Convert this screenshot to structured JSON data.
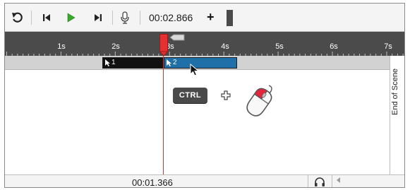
{
  "toolbar": {
    "icons": [
      "undo-icon",
      "skip-to-start-icon",
      "play-icon",
      "step-forward-icon",
      "microphone-icon"
    ],
    "time": "00:02.866",
    "plus": "+"
  },
  "ruler": {
    "labels": [
      "1s",
      "2s",
      "3s",
      "4s",
      "5s",
      "6s",
      "7s"
    ]
  },
  "track": {
    "clips": [
      {
        "label": "1",
        "color": "#111111"
      },
      {
        "label": "2",
        "color": "#1f6fa8"
      }
    ]
  },
  "end_of_scene_label": "End of Scene",
  "hint": {
    "key_label": "CTRL",
    "plus": "+"
  },
  "status": {
    "time": "00:01.366"
  },
  "colors": {
    "accent_play": "#3aa82b",
    "playhead": "#e53030",
    "ruler_bg": "#4b4b4b",
    "clip_selected": "#1f6fa8"
  }
}
